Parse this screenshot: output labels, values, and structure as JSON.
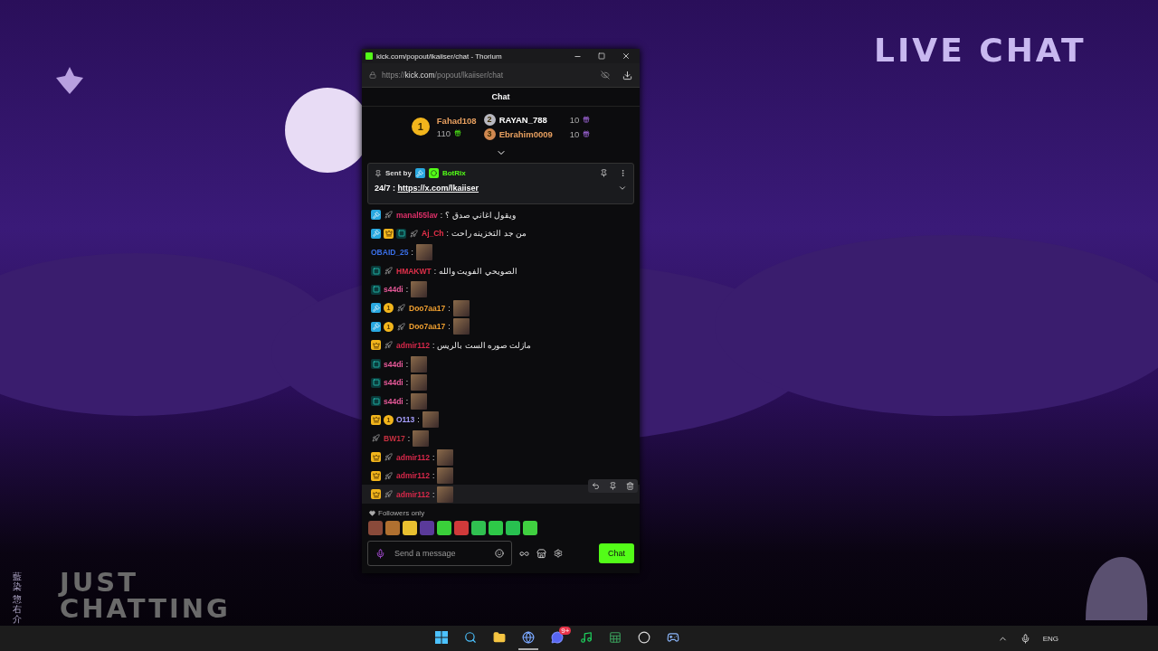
{
  "overlay": {
    "title": "LIVE CHAT",
    "category": [
      "JUST",
      "CHATTING"
    ],
    "vertical_text": [
      "藍染",
      "惣右介"
    ]
  },
  "window": {
    "title": "kick.com/popout/lkaiiser/chat - Thorium",
    "url_prefix": "https://",
    "url_host": "kick.com",
    "url_path": "/popout/lkaiiser/chat"
  },
  "chat": {
    "header": "Chat",
    "leaderboard": [
      {
        "rank": "1",
        "name": "Fahad108",
        "amount": "110",
        "color": "#e8a060"
      },
      {
        "rank": "2",
        "name": "RAYAN_788",
        "amount": "10",
        "color": "#ffffff"
      },
      {
        "rank": "3",
        "name": "Ebrahim0009",
        "amount": "10",
        "color": "#e8a060"
      }
    ],
    "pinned": {
      "sent_by": "Sent by",
      "author": "BotRix",
      "message": "24/7 : ",
      "link": "https://x.com/lkaiiser"
    },
    "messages": [
      {
        "badges": [
          {
            "kind": "mod"
          },
          {
            "kind": "sub"
          }
        ],
        "user": "manal55lav",
        "color": "#e0306a",
        "kind": "text",
        "text": "ويقول اغاني صدق ؟",
        "highlighted": false
      },
      {
        "badges": [
          {
            "kind": "mod"
          },
          {
            "kind": "vip"
          },
          {
            "kind": "og"
          },
          {
            "kind": "sub"
          }
        ],
        "user": "Aj_Ch",
        "color": "#e8304a",
        "kind": "text",
        "text": "من جد التخزينه راحت",
        "highlighted": false
      },
      {
        "user": "OBAID_25",
        "color": "#3a6fe8",
        "kind": "emote",
        "highlighted": false
      },
      {
        "badges": [
          {
            "kind": "og"
          },
          {
            "kind": "sub"
          }
        ],
        "user": "HMAKWT",
        "color": "#e0304a",
        "kind": "text",
        "text": "الصويحي الفويت والله",
        "highlighted": false
      },
      {
        "badges": [
          {
            "kind": "og"
          }
        ],
        "user": "s44di",
        "color": "#e85a9a",
        "kind": "emote",
        "highlighted": false
      },
      {
        "badges": [
          {
            "kind": "mod"
          },
          {
            "kind": "gifter",
            "text": "1"
          },
          {
            "kind": "sub"
          }
        ],
        "user": "Doo7aa17",
        "color": "#f0a030",
        "kind": "emote",
        "highlighted": false
      },
      {
        "badges": [
          {
            "kind": "mod"
          },
          {
            "kind": "gifter",
            "text": "1"
          },
          {
            "kind": "sub"
          }
        ],
        "user": "Doo7aa17",
        "color": "#f0a030",
        "kind": "emote",
        "highlighted": false
      },
      {
        "badges": [
          {
            "kind": "vip"
          },
          {
            "kind": "sub"
          }
        ],
        "user": "admir112",
        "color": "#d8284a",
        "kind": "text",
        "text": "مازلت صوره الست بالريس",
        "highlighted": false
      },
      {
        "badges": [
          {
            "kind": "og"
          }
        ],
        "user": "s44di",
        "color": "#e85a9a",
        "kind": "emote",
        "highlighted": false
      },
      {
        "badges": [
          {
            "kind": "og"
          }
        ],
        "user": "s44di",
        "color": "#e85a9a",
        "kind": "emote",
        "highlighted": false
      },
      {
        "badges": [
          {
            "kind": "og"
          }
        ],
        "user": "s44di",
        "color": "#e85a9a",
        "kind": "emote",
        "highlighted": false
      },
      {
        "badges": [
          {
            "kind": "vip"
          },
          {
            "kind": "gifter",
            "text": "1"
          }
        ],
        "user": "O113",
        "color": "#a8a0ff",
        "kind": "emote",
        "highlighted": false
      },
      {
        "badges": [
          {
            "kind": "sub"
          }
        ],
        "user": "BW17",
        "color": "#c83040",
        "kind": "emote",
        "highlighted": false
      },
      {
        "badges": [
          {
            "kind": "vip"
          },
          {
            "kind": "sub"
          }
        ],
        "user": "admir112",
        "color": "#d8284a",
        "kind": "emote",
        "highlighted": false
      },
      {
        "badges": [
          {
            "kind": "vip"
          },
          {
            "kind": "sub"
          }
        ],
        "user": "admir112",
        "color": "#d8284a",
        "kind": "emote",
        "highlighted": false
      },
      {
        "badges": [
          {
            "kind": "vip"
          },
          {
            "kind": "sub"
          }
        ],
        "user": "admir112",
        "color": "#d8284a",
        "kind": "emote",
        "highlighted": true
      }
    ],
    "separator": ":",
    "mode": "Followers only",
    "input": {
      "placeholder": "Send a message"
    },
    "send": "Chat"
  },
  "taskbar": {
    "apps": [
      {
        "kind": "start",
        "selected": false
      },
      {
        "kind": "search",
        "selected": false
      },
      {
        "kind": "files",
        "selected": false
      },
      {
        "kind": "browser",
        "selected": true
      },
      {
        "kind": "discord",
        "selected": false,
        "badge": "9+"
      },
      {
        "kind": "music",
        "selected": false
      },
      {
        "kind": "sheet",
        "selected": false
      },
      {
        "kind": "recorder",
        "selected": false
      },
      {
        "kind": "steam",
        "selected": false
      }
    ],
    "language": "ENG"
  }
}
